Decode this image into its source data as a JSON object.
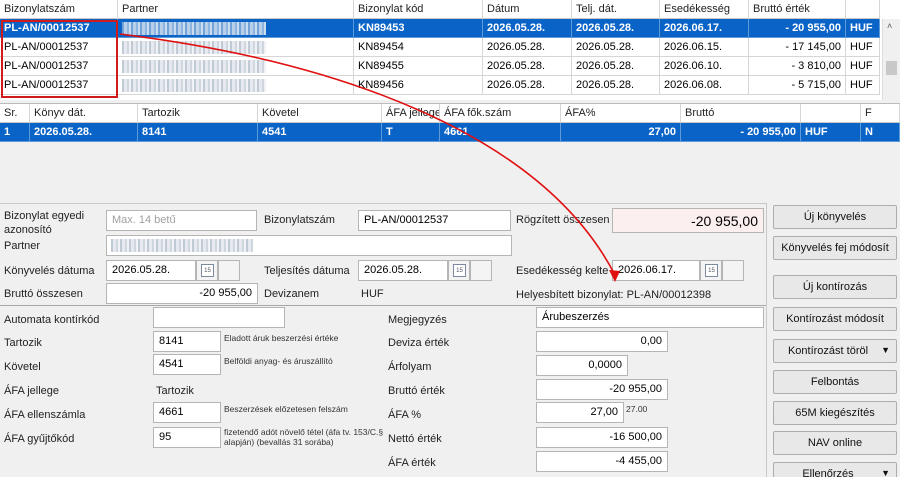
{
  "top_grid": {
    "headers": [
      "Bizonylatszám",
      "Partner",
      "Bizonylat kód",
      "Dátum",
      "Telj. dát.",
      "Esedékesség",
      "Bruttó érték",
      ""
    ],
    "rows": [
      {
        "szam": "PL-AN/00012537",
        "kod": "KN89453",
        "datum": "2026.05.28.",
        "telj": "2026.05.28.",
        "esed": "2026.06.17.",
        "brutto": "- 20 955,00",
        "deviza": "HUF"
      },
      {
        "szam": "PL-AN/00012537",
        "kod": "KN89454",
        "datum": "2026.05.28.",
        "telj": "2026.05.28.",
        "esed": "2026.06.15.",
        "brutto": "- 17 145,00",
        "deviza": "HUF"
      },
      {
        "szam": "PL-AN/00012537",
        "kod": "KN89455",
        "datum": "2026.05.28.",
        "telj": "2026.05.28.",
        "esed": "2026.06.10.",
        "brutto": "- 3 810,00",
        "deviza": "HUF"
      },
      {
        "szam": "PL-AN/00012537",
        "kod": "KN89456",
        "datum": "2026.05.28.",
        "telj": "2026.05.28.",
        "esed": "2026.06.08.",
        "brutto": "- 5 715,00",
        "deviza": "HUF"
      }
    ]
  },
  "mid_grid": {
    "headers": [
      "Sr.",
      "Könyv dát.",
      "Tartozik",
      "Követel",
      "ÁFA jellege",
      "ÁFA fők.szám",
      "ÁFA%",
      "Bruttó",
      "",
      "F"
    ],
    "row": {
      "sr": "1",
      "datum": "2026.05.28.",
      "tartozik": "8141",
      "kovetel": "4541",
      "afa_jelleg": "T",
      "afa_fokszam": "4661",
      "afa_pct": "27,00",
      "brutto": "- 20 955,00",
      "deviza": "HUF",
      "f": "N"
    }
  },
  "header_form": {
    "egyedi_label": "Bizonylat egyedi azonosító",
    "egyedi_placeholder": "Max. 14 betű",
    "szam_label": "Bizonylatszám",
    "szam_value": "PL-AN/00012537",
    "rogzitett_label": "Rögzített összesen",
    "rogzitett_value": "-20 955,00",
    "partner_label": "Partner",
    "konyv_datum_label": "Könyvelés dátuma",
    "konyv_datum_value": "2026.05.28.",
    "telj_label": "Teljesítés dátuma",
    "telj_value": "2026.05.28.",
    "esed_label": "Esedékesség kelte",
    "esed_value": "2026.06.17.",
    "brutto_label": "Bruttó összesen",
    "brutto_value": "-20 955,00",
    "devizanem_label": "Devizanem",
    "devizanem_value": "HUF",
    "helyesbitett": "Helyesbített bizonylat: PL-AN/00012398",
    "cal_icon_text": "15"
  },
  "detail_form": {
    "automata_label": "Automata kontírkód",
    "automata_value": "",
    "tartozik_label": "Tartozik",
    "tartozik_value": "8141",
    "tartozik_desc": "Eladott áruk beszerzési értéke",
    "kovetel_label": "Követel",
    "kovetel_value": "4541",
    "kovetel_desc": "Belföldi anyag- és áruszállító",
    "afa_jellege_label": "ÁFA jellege",
    "afa_jellege_value": "Tartozik",
    "afa_ellen_label": "ÁFA ellenszámla",
    "afa_ellen_value": "4661",
    "afa_ellen_desc": "Beszerzések előzetesen felszám",
    "afa_gyujto_label": "ÁFA gyűjtőkód",
    "afa_gyujto_value": "95",
    "afa_gyujto_desc": "fizetendő adót növelő tétel (áfa tv. 153/C.§ alapján) (bevallás 31 sorába)",
    "megjegyzes_label": "Megjegyzés",
    "megjegyzes_value": "Árubeszerzés",
    "deviza_ertek_label": "Deviza érték",
    "deviza_ertek_value": "0,00",
    "arfolyam_label": "Árfolyam",
    "arfolyam_value": "0,0000",
    "brutto_ertek_label": "Bruttó érték",
    "brutto_ertek_value": "-20 955,00",
    "afa_pct_label": "ÁFA %",
    "afa_pct_value": "27,00",
    "afa_pct_side": "27.00",
    "netto_label": "Nettó érték",
    "netto_value": "-16 500,00",
    "afa_ertek_label": "ÁFA érték",
    "afa_ertek_value": "-4 455,00"
  },
  "buttons": {
    "uj_konyveles": "Új könyvelés",
    "fej_modosit": "Könyvelés fej módosít",
    "uj_kontirozas": "Új kontírozás",
    "kontirozas_modosit": "Kontírozást módosít",
    "kontirozas_torol": "Kontírozást töröl",
    "felbontas": "Felbontás",
    "kiegeszites": "65M kiegészítés",
    "nav_online": "NAV online",
    "ellenorzes": "Ellenőrzés"
  },
  "colors": {
    "selection": "#0a64c8",
    "highlight_box": "#d11a1a",
    "arrow": "#e01010"
  }
}
